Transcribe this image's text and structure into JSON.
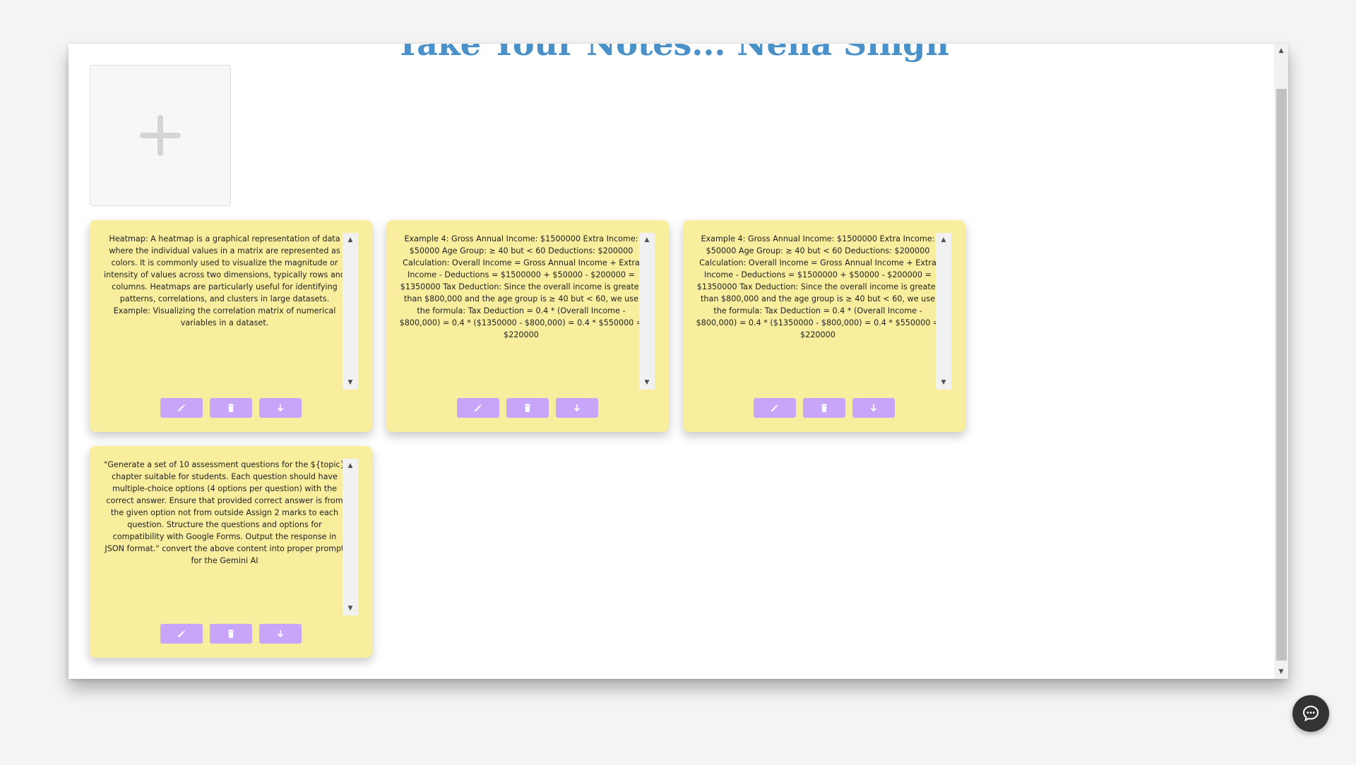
{
  "page": {
    "title": "Take Your Notes... Neha Singh"
  },
  "add_note": {
    "icon": "plus-icon"
  },
  "notes": [
    {
      "text": "Heatmap: A heatmap is a graphical representation of data where the individual values in a matrix are represented as colors. It is commonly used to visualize the magnitude or intensity of values across two dimensions, typically rows and columns. Heatmaps are particularly useful for identifying patterns, correlations, and clusters in large datasets. Example: Visualizing the correlation matrix of numerical variables in a dataset."
    },
    {
      "text": "Example 4: Gross Annual Income: $1500000 Extra Income: $50000 Age Group: ≥ 40 but < 60 Deductions: $200000 Calculation: Overall Income = Gross Annual Income + Extra Income - Deductions = $1500000 + $50000 - $200000 = $1350000 Tax Deduction: Since the overall income is greater than $800,000 and the age group is ≥ 40 but < 60, we use the formula: Tax Deduction = 0.4 * (Overall Income - $800,000) = 0.4 * ($1350000 - $800,000) = 0.4 * $550000 = $220000"
    },
    {
      "text": "Example 4: Gross Annual Income: $1500000 Extra Income: $50000 Age Group: ≥ 40 but < 60 Deductions: $200000 Calculation: Overall Income = Gross Annual Income + Extra Income - Deductions = $1500000 + $50000 - $200000 = $1350000 Tax Deduction: Since the overall income is greater than $800,000 and the age group is ≥ 40 but < 60, we use the formula: Tax Deduction = 0.4 * (Overall Income - $800,000) = 0.4 * ($1350000 - $800,000) = 0.4 * $550000 = $220000"
    },
    {
      "text": "\"Generate a set of 10 assessment questions for the ${topic} chapter suitable for students. Each question should have multiple-choice options (4 options per question) with the correct answer. Ensure that provided correct answer is from the given option not from outside Assign 2 marks to each question. Structure the questions and options for compatibility with Google Forms. Output the response in JSON format.\" convert the above content into proper prompt for the Gemini AI"
    }
  ],
  "note_actions": {
    "edit_icon": "pencil-icon",
    "delete_icon": "trash-icon",
    "download_icon": "arrow-down-icon"
  },
  "colors": {
    "title": "#4a90c9",
    "note_bg": "#f9ee9e",
    "note_button": "#c9a5fa",
    "chat_button": "#333333"
  },
  "chat": {
    "icon": "chat-icon"
  }
}
